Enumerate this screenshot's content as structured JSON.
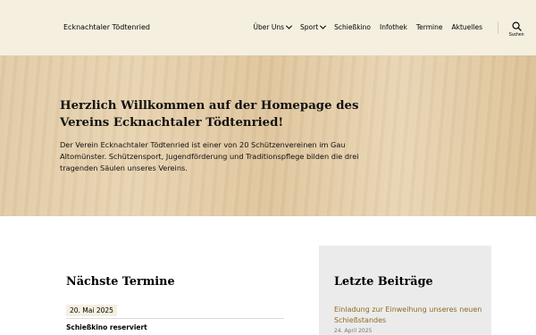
{
  "header": {
    "site_title": "Ecknachtaler Tödtenried",
    "nav": [
      {
        "label": "Über Uns",
        "has_dropdown": true
      },
      {
        "label": "Sport",
        "has_dropdown": true
      },
      {
        "label": "Schießkino",
        "has_dropdown": false
      },
      {
        "label": "Infothek",
        "has_dropdown": false
      },
      {
        "label": "Termine",
        "has_dropdown": false
      },
      {
        "label": "Aktuelles",
        "has_dropdown": false
      }
    ],
    "search_label": "Suchen"
  },
  "hero": {
    "title": "Herzlich Willkommen auf der Homepage des Vereins Ecknachtaler Tödtenried!",
    "text": "Der Verein Ecknachtaler Tödtenried ist einer von 20 Schützenvereinen im Gau Altomünster. Schützensport, Jugendförderung und Traditionspflege bilden die drei tragenden Säulen unseres Vereins."
  },
  "events": {
    "title": "Nächste Termine",
    "items": [
      {
        "date": "20. Mai 2025",
        "title": "Schießkino reserviert"
      }
    ]
  },
  "sidebar": {
    "title": "Letzte Beiträge",
    "posts": [
      {
        "title": "Einladung zur Einweihung unseres neuen Schießstandes",
        "date": "24. April 2025"
      }
    ]
  },
  "colors": {
    "header_bg": "#f5efe0",
    "link": "#8a6d1f",
    "sidebar_bg": "#ebebeb"
  }
}
